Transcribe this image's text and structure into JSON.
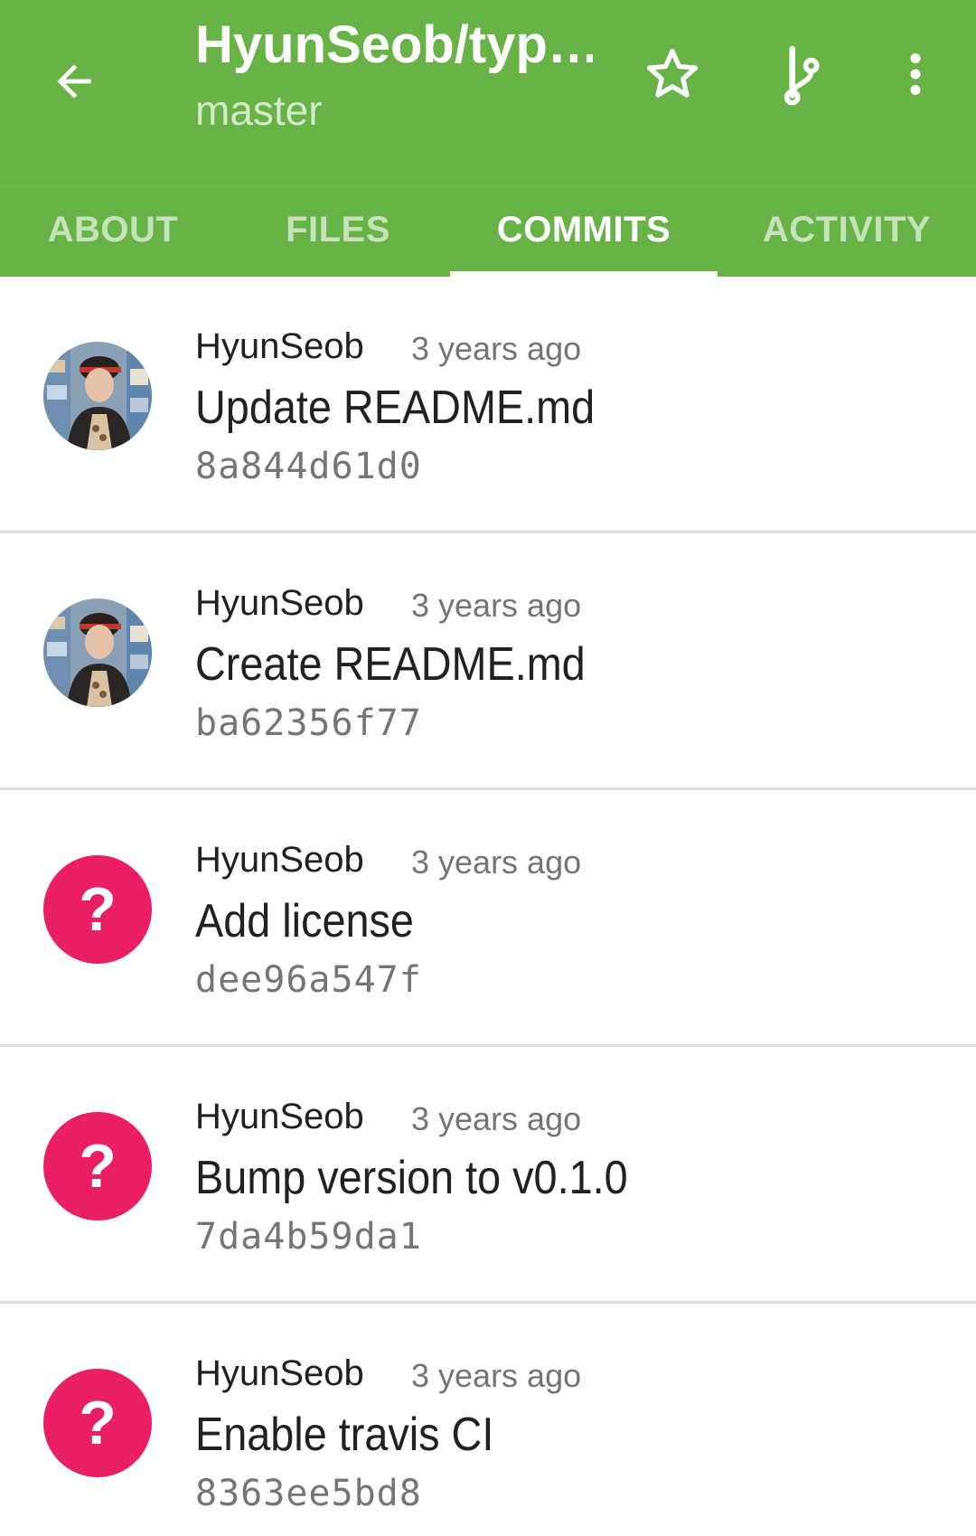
{
  "colors": {
    "primary": "#67b346",
    "unknown_avatar": "#e91e63",
    "primary_text": "#212121",
    "secondary_text": "#757575",
    "divider": "#dedede"
  },
  "toolbar": {
    "back_icon": "arrow-back-icon",
    "title": "HyunSeob/typ…",
    "subtitle": "master",
    "star_icon": "star-outline-icon",
    "branch_icon": "git-branch-icon",
    "more_icon": "more-vert-icon"
  },
  "tabs": [
    {
      "label": "ABOUT",
      "active": false
    },
    {
      "label": "FILES",
      "active": false
    },
    {
      "label": "COMMITS",
      "active": true
    },
    {
      "label": "ACTIVITY",
      "active": false
    }
  ],
  "commits": [
    {
      "author": "HyunSeob",
      "time": "3 years ago",
      "message": "Update README.md",
      "sha": "8a844d61d0",
      "avatar": "photo"
    },
    {
      "author": "HyunSeob",
      "time": "3 years ago",
      "message": "Create README.md",
      "sha": "ba62356f77",
      "avatar": "photo"
    },
    {
      "author": "HyunSeob",
      "time": "3 years ago",
      "message": "Add license",
      "sha": "dee96a547f",
      "avatar": "unknown",
      "avatar_glyph": "?"
    },
    {
      "author": "HyunSeob",
      "time": "3 years ago",
      "message": "Bump version to v0.1.0",
      "sha": "7da4b59da1",
      "avatar": "unknown",
      "avatar_glyph": "?"
    },
    {
      "author": "HyunSeob",
      "time": "3 years ago",
      "message": "Enable travis CI",
      "sha": "8363ee5bd8",
      "avatar": "unknown",
      "avatar_glyph": "?"
    }
  ]
}
